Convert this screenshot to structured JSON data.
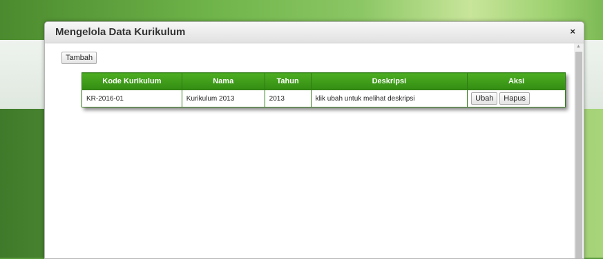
{
  "modal": {
    "title": "Mengelola Data Kurikulum",
    "close_label": "×",
    "add_button": "Tambah"
  },
  "table": {
    "headers": [
      "Kode Kurikulum",
      "Nama",
      "Tahun",
      "Deskripsi",
      "Aksi"
    ],
    "rows": [
      {
        "kode": "KR-2016-01",
        "nama": "Kurikulum 2013",
        "tahun": "2013",
        "deskripsi": "klik ubah untuk melihat deskripsi",
        "edit_label": "Ubah",
        "delete_label": "Hapus"
      }
    ]
  },
  "colors": {
    "header_green": "#3d9c18",
    "border_green": "#2f7a15"
  }
}
